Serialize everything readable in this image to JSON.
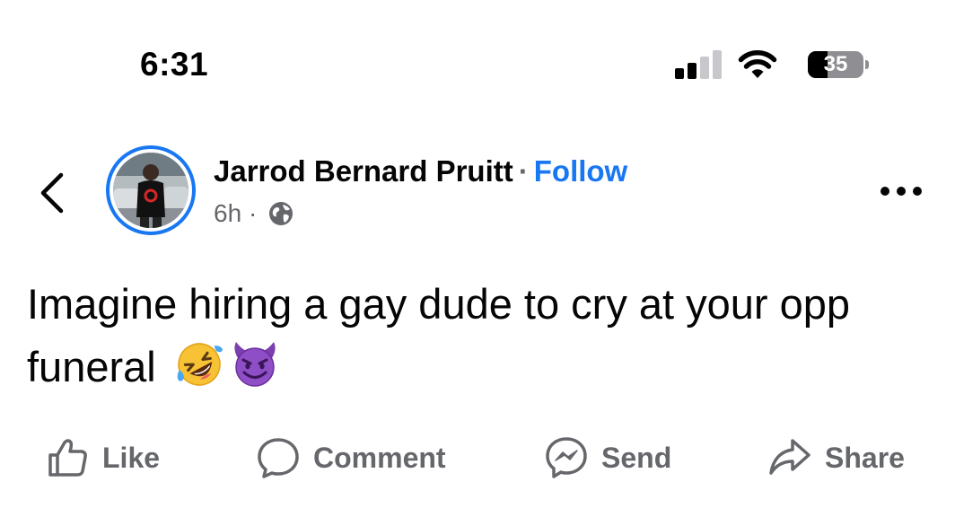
{
  "status_bar": {
    "time": "6:31",
    "battery_level": "35",
    "battery_fraction": 0.35,
    "signal_bars_active": 2,
    "signal_bars_total": 4
  },
  "post": {
    "author_name": "Jarrod Bernard Pruitt",
    "separator": "·",
    "follow_label": "Follow",
    "time_ago": "6h",
    "meta_separator": "·",
    "audience_icon": "globe-icon",
    "text": "Imagine hiring a gay dude to cry at your opp funeral",
    "emojis": [
      "rolling-on-floor-laughing-emoji",
      "smiling-face-with-horns-emoji"
    ]
  },
  "actions": {
    "like": {
      "label": "Like",
      "icon": "thumbs-up-icon"
    },
    "comment": {
      "label": "Comment",
      "icon": "comment-bubble-icon"
    },
    "send": {
      "label": "Send",
      "icon": "messenger-icon"
    },
    "share": {
      "label": "Share",
      "icon": "share-arrow-icon"
    }
  },
  "colors": {
    "accent": "#1877f2",
    "secondary_text": "#65676b",
    "primary_text": "#050505"
  }
}
